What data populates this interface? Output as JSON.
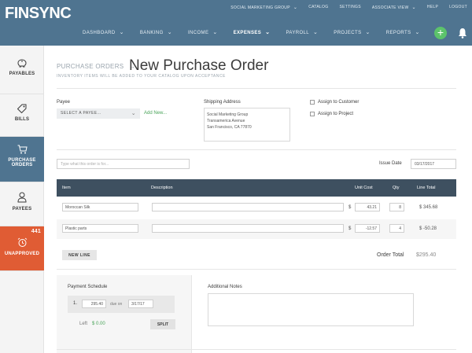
{
  "app": {
    "logo": "FINSYNC"
  },
  "topnav": {
    "account": "SOCIAL MARKETING GROUP",
    "catalog": "CATALOG",
    "settings": "SETTINGS",
    "associate_view": "ASSOCIATE VIEW",
    "help": "HELP",
    "logout": "LOGOUT"
  },
  "mainnav": {
    "items": [
      {
        "label": "DASHBOARD"
      },
      {
        "label": "BANKING"
      },
      {
        "label": "INCOME"
      },
      {
        "label": "EXPENSES"
      },
      {
        "label": "PAYROLL"
      },
      {
        "label": "PROJECTS"
      },
      {
        "label": "REPORTS"
      }
    ],
    "active": "EXPENSES",
    "plus_symbol": "+"
  },
  "sidebar": {
    "items": [
      {
        "label": "PAYABLES",
        "icon": "piggy-bank-icon"
      },
      {
        "label": "BILLS",
        "icon": "tag-icon"
      },
      {
        "label_line1": "PURCHASE",
        "label_line2": "ORDERS",
        "icon": "cart-icon"
      },
      {
        "label": "PAYEES",
        "icon": "person-icon"
      },
      {
        "label": "UNAPPROVED",
        "icon": "alarm-clock-icon",
        "badge": "441"
      }
    ]
  },
  "page": {
    "breadcrumb": "PURCHASE ORDERS",
    "breadcrumb_arrow": "→",
    "title": "New Purchase Order",
    "subtitle": "INVENTORY ITEMS WILL BE ADDED TO YOUR CATALOG UPON ACCEPTANCE"
  },
  "form": {
    "payee_label": "Payee",
    "payee_select": "SELECT A PAYEE...",
    "add_new": "Add New...",
    "shipping_label": "Shipping Address",
    "shipping_lines": [
      "Social Marketing Group",
      "Transamerica Avenue",
      "San Francisco, CA  77870"
    ],
    "assign_customer": "Assign to Customer",
    "assign_project": "Assign to Project",
    "memo_placeholder": "Type what this order is for...",
    "issue_date_label": "Issue Date",
    "issue_date": "03/17/2017"
  },
  "table": {
    "headers": {
      "item": "Item",
      "description": "Description",
      "unit_cost": "Unit Cost",
      "qty": "Qty",
      "line_total": "Line Total"
    },
    "currency_symbol": "$",
    "rows": [
      {
        "item": "Moroccan Silk",
        "description": "",
        "unit_cost": "43.21",
        "qty": "8",
        "line_total": "$ 345.68"
      },
      {
        "item": "Plastic parts",
        "description": "",
        "unit_cost": "-12.57",
        "qty": "4",
        "line_total": "$ -50.28"
      }
    ],
    "new_line": "NEW LINE",
    "order_total_label": "Order Total",
    "order_total": "$295.40"
  },
  "schedule": {
    "label": "Payment Schedule",
    "number": "1.",
    "amount": "295.40",
    "due_on": "due on",
    "due_date": "3/17/17",
    "left_label": "Left",
    "left_value": "$ 0.00",
    "split": "SPLIT"
  },
  "notes": {
    "label": "Additional Notes"
  },
  "colors": {
    "header": "#4f7490",
    "table_head": "#3e5060",
    "accent_green": "#5cc36b",
    "unapproved": "#e05c34"
  }
}
